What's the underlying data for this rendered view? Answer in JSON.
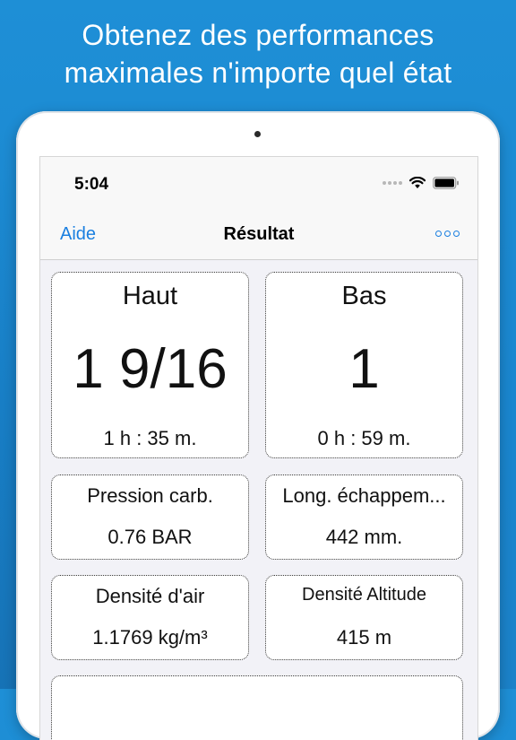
{
  "headline": {
    "line1": "Obtenez des performances",
    "line2": "maximales n'importe quel état"
  },
  "status_bar": {
    "time": "5:04"
  },
  "nav": {
    "left_label": "Aide",
    "title": "Résultat"
  },
  "results": {
    "high": {
      "label": "Haut",
      "value": "1 9/16",
      "time": "1 h : 35 m."
    },
    "low": {
      "label": "Bas",
      "value": "1",
      "time": "0 h : 59 m."
    },
    "fuel_pressure": {
      "label": "Pression carb.",
      "value": "0.76 BAR"
    },
    "exhaust_length": {
      "label": "Long. échappem...",
      "value": "442 mm."
    },
    "air_density": {
      "label": "Densité d'air",
      "value": "1.1769 kg/m³"
    },
    "density_altitude": {
      "label": "Densité Altitude",
      "value": "415 m"
    }
  },
  "colors": {
    "background": "#1e8fd6",
    "accent": "#1a7fe0"
  }
}
